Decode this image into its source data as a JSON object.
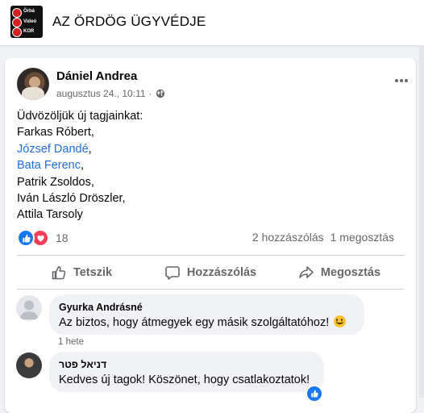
{
  "group": {
    "title": "AZ ÖRDÖG ÜGYVÉDJE",
    "thumb_lines": [
      "Örbá",
      "Videó",
      "KOR"
    ]
  },
  "post": {
    "author": "Dániel Andrea",
    "timestamp": "augusztus 24., 10:11",
    "separator": "·",
    "privacy_icon": "globe-icon",
    "lines": [
      {
        "text": "Üdvözöljük új tagjainkat:",
        "mention": false
      },
      {
        "text": "Farkas Róbert,",
        "mention": false
      },
      {
        "text": "József Dandé",
        "suffix": ",",
        "mention": true
      },
      {
        "text": "Bata Ferenc",
        "suffix": ",",
        "mention": true
      },
      {
        "text": "Patrik Zsoldos,",
        "mention": false
      },
      {
        "text": "Iván László Dröszler,",
        "mention": false
      },
      {
        "text": "Attila Tarsoly",
        "mention": false
      }
    ],
    "reaction_count": "18",
    "comments_count": "2 hozzászólás",
    "shares_count": "1 megosztás",
    "actions": {
      "like": "Tetszik",
      "comment": "Hozzászólás",
      "share": "Megosztás"
    }
  },
  "comments": [
    {
      "name": "Gyurka Andrásné",
      "text": "Az biztos, hogy átmegyek egy másik szolgáltatóhoz!",
      "emoji": "smile-emoji",
      "time": "1 hete"
    },
    {
      "name": "דניאל פטר",
      "text": "Kedves új tagok! Köszönet, hogy csatlakoztatok!",
      "reaction": "like"
    }
  ],
  "colors": {
    "accent": "#1877f2",
    "mention": "#216fdb",
    "love": "#f33e58",
    "secondary_text": "#65676b",
    "background": "#f0f2f5"
  }
}
